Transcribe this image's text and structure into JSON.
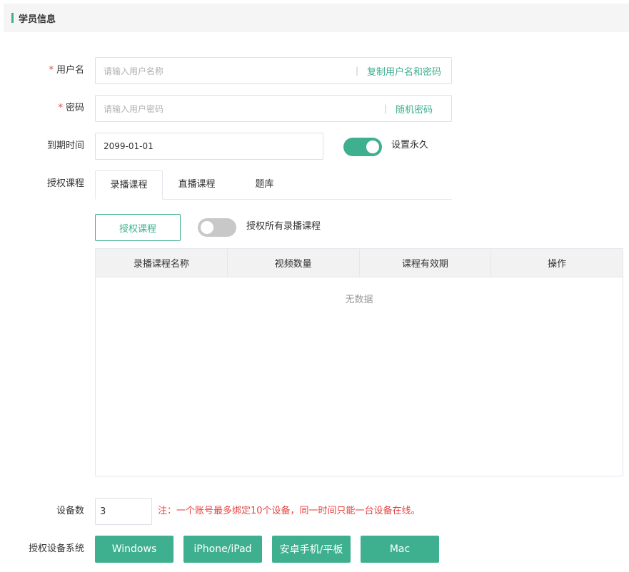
{
  "section": {
    "title": "学员信息"
  },
  "username": {
    "required_mark": "*",
    "label": "用户名",
    "placeholder": "请输入用户名称",
    "separator": "|",
    "action": "复制用户名和密码"
  },
  "password": {
    "required_mark": "*",
    "label": "密码",
    "placeholder": "请输入用户密码",
    "separator": "|",
    "action": "随机密码"
  },
  "expire": {
    "label": "到期时间",
    "value": "2099-01-01",
    "permanent_label": "设置永久",
    "permanent_on": true
  },
  "auth": {
    "label": "授权课程",
    "tabs": [
      {
        "label": "录播课程",
        "active": true
      },
      {
        "label": "直播课程",
        "active": false
      },
      {
        "label": "题库",
        "active": false
      }
    ],
    "button": "授权课程",
    "auth_all_label": "授权所有录播课程",
    "auth_all_on": false,
    "table": {
      "columns": [
        "录播课程名称",
        "视频数量",
        "课程有效期",
        "操作"
      ],
      "empty_text": "无数据"
    }
  },
  "devices": {
    "label": "设备数",
    "value": "3",
    "note": "注：一个账号最多绑定10个设备，同一时间只能一台设备在线。"
  },
  "systems": {
    "label": "授权设备系统",
    "buttons": [
      "Windows",
      "iPhone/iPad",
      "安卓手机/平板",
      "Mac"
    ]
  },
  "colors": {
    "accent": "#3eb08f",
    "danger": "#e64340"
  }
}
